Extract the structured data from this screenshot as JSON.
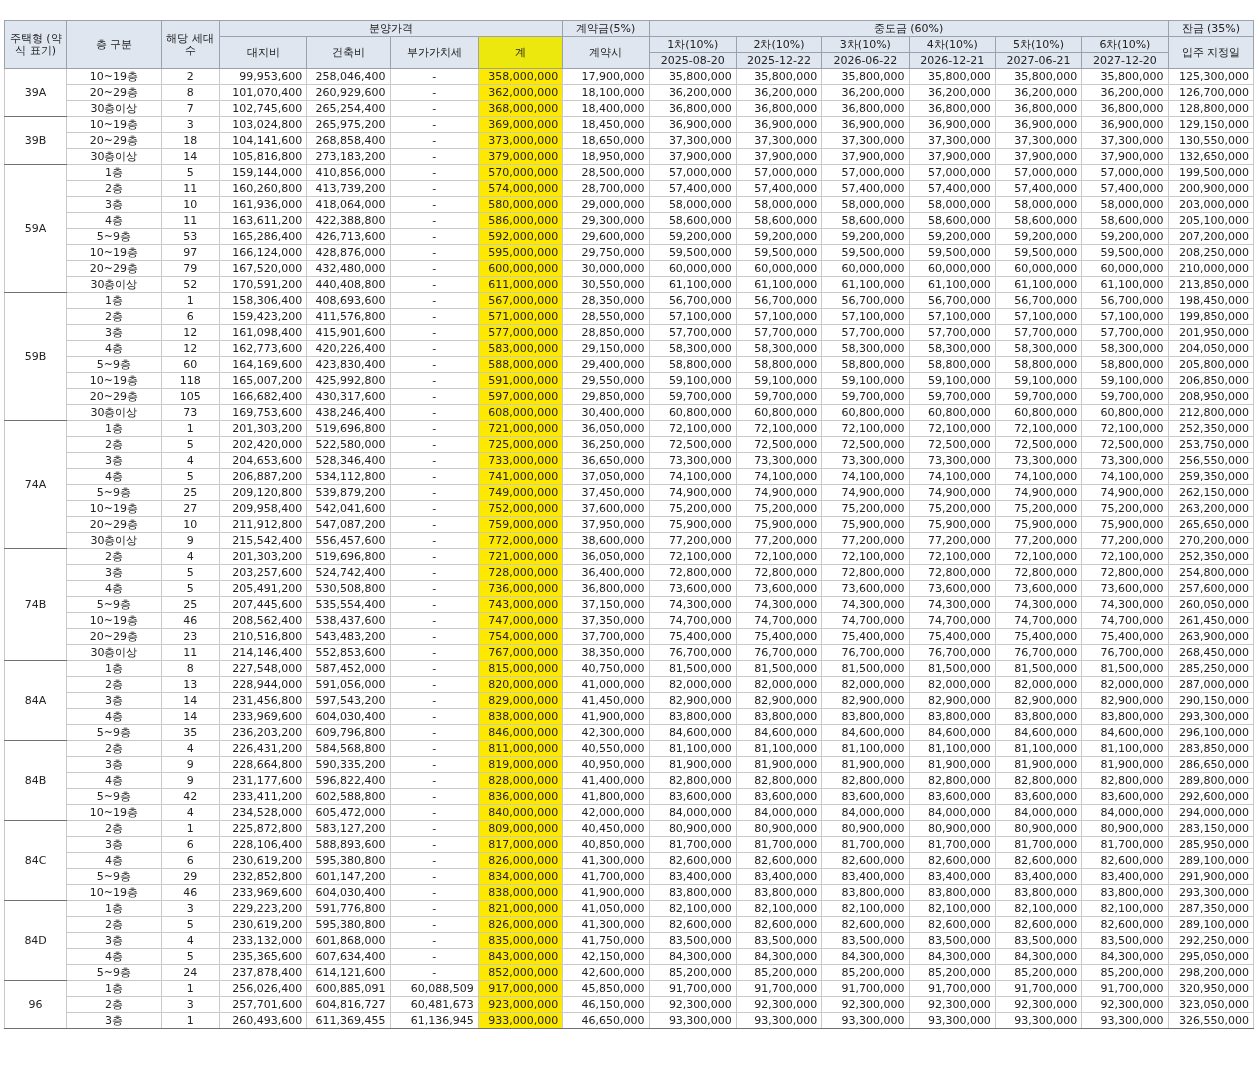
{
  "header": {
    "housing_type": "주택형 (약식 표기)",
    "floor": "층 구분",
    "units": "해당 세대수",
    "price": {
      "label": "분양가격",
      "columns": [
        {
          "label": "대지비",
          "highlighted": false
        },
        {
          "label": "건축비",
          "highlighted": false
        },
        {
          "label": "부가가치세",
          "highlighted": false
        },
        {
          "label": "계",
          "highlighted": true
        }
      ]
    },
    "deposit": {
      "label": "계약금(5%)",
      "sub": "계약시"
    },
    "middle": {
      "label": "중도금 (60%)",
      "installments": [
        {
          "label": "1차(10%)",
          "date": "2025-08-20"
        },
        {
          "label": "2차(10%)",
          "date": "2025-12-22"
        },
        {
          "label": "3차(10%)",
          "date": "2026-06-22"
        },
        {
          "label": "4차(10%)",
          "date": "2026-12-21"
        },
        {
          "label": "5차(10%)",
          "date": "2027-06-21"
        },
        {
          "label": "6차(10%)",
          "date": "2027-12-20"
        }
      ]
    },
    "balance": {
      "label": "잔금 (35%)",
      "sub": "입주 지정일"
    }
  },
  "groups": [
    {
      "type": "39A",
      "rows": [
        [
          "10~19층",
          "2",
          "99,953,600",
          "258,046,400",
          "-",
          "358,000,000",
          "17,900,000",
          "35,800,000",
          "35,800,000",
          "35,800,000",
          "35,800,000",
          "35,800,000",
          "35,800,000",
          "125,300,000"
        ],
        [
          "20~29층",
          "8",
          "101,070,400",
          "260,929,600",
          "-",
          "362,000,000",
          "18,100,000",
          "36,200,000",
          "36,200,000",
          "36,200,000",
          "36,200,000",
          "36,200,000",
          "36,200,000",
          "126,700,000"
        ],
        [
          "30층이상",
          "7",
          "102,745,600",
          "265,254,400",
          "-",
          "368,000,000",
          "18,400,000",
          "36,800,000",
          "36,800,000",
          "36,800,000",
          "36,800,000",
          "36,800,000",
          "36,800,000",
          "128,800,000"
        ]
      ]
    },
    {
      "type": "39B",
      "rows": [
        [
          "10~19층",
          "3",
          "103,024,800",
          "265,975,200",
          "-",
          "369,000,000",
          "18,450,000",
          "36,900,000",
          "36,900,000",
          "36,900,000",
          "36,900,000",
          "36,900,000",
          "36,900,000",
          "129,150,000"
        ],
        [
          "20~29층",
          "18",
          "104,141,600",
          "268,858,400",
          "-",
          "373,000,000",
          "18,650,000",
          "37,300,000",
          "37,300,000",
          "37,300,000",
          "37,300,000",
          "37,300,000",
          "37,300,000",
          "130,550,000"
        ],
        [
          "30층이상",
          "14",
          "105,816,800",
          "273,183,200",
          "-",
          "379,000,000",
          "18,950,000",
          "37,900,000",
          "37,900,000",
          "37,900,000",
          "37,900,000",
          "37,900,000",
          "37,900,000",
          "132,650,000"
        ]
      ]
    },
    {
      "type": "59A",
      "rows": [
        [
          "1층",
          "5",
          "159,144,000",
          "410,856,000",
          "-",
          "570,000,000",
          "28,500,000",
          "57,000,000",
          "57,000,000",
          "57,000,000",
          "57,000,000",
          "57,000,000",
          "57,000,000",
          "199,500,000"
        ],
        [
          "2층",
          "11",
          "160,260,800",
          "413,739,200",
          "-",
          "574,000,000",
          "28,700,000",
          "57,400,000",
          "57,400,000",
          "57,400,000",
          "57,400,000",
          "57,400,000",
          "57,400,000",
          "200,900,000"
        ],
        [
          "3층",
          "10",
          "161,936,000",
          "418,064,000",
          "-",
          "580,000,000",
          "29,000,000",
          "58,000,000",
          "58,000,000",
          "58,000,000",
          "58,000,000",
          "58,000,000",
          "58,000,000",
          "203,000,000"
        ],
        [
          "4층",
          "11",
          "163,611,200",
          "422,388,800",
          "-",
          "586,000,000",
          "29,300,000",
          "58,600,000",
          "58,600,000",
          "58,600,000",
          "58,600,000",
          "58,600,000",
          "58,600,000",
          "205,100,000"
        ],
        [
          "5~9층",
          "53",
          "165,286,400",
          "426,713,600",
          "-",
          "592,000,000",
          "29,600,000",
          "59,200,000",
          "59,200,000",
          "59,200,000",
          "59,200,000",
          "59,200,000",
          "59,200,000",
          "207,200,000"
        ],
        [
          "10~19층",
          "97",
          "166,124,000",
          "428,876,000",
          "-",
          "595,000,000",
          "29,750,000",
          "59,500,000",
          "59,500,000",
          "59,500,000",
          "59,500,000",
          "59,500,000",
          "59,500,000",
          "208,250,000"
        ],
        [
          "20~29층",
          "79",
          "167,520,000",
          "432,480,000",
          "-",
          "600,000,000",
          "30,000,000",
          "60,000,000",
          "60,000,000",
          "60,000,000",
          "60,000,000",
          "60,000,000",
          "60,000,000",
          "210,000,000"
        ],
        [
          "30층이상",
          "52",
          "170,591,200",
          "440,408,800",
          "-",
          "611,000,000",
          "30,550,000",
          "61,100,000",
          "61,100,000",
          "61,100,000",
          "61,100,000",
          "61,100,000",
          "61,100,000",
          "213,850,000"
        ]
      ]
    },
    {
      "type": "59B",
      "rows": [
        [
          "1층",
          "1",
          "158,306,400",
          "408,693,600",
          "-",
          "567,000,000",
          "28,350,000",
          "56,700,000",
          "56,700,000",
          "56,700,000",
          "56,700,000",
          "56,700,000",
          "56,700,000",
          "198,450,000"
        ],
        [
          "2층",
          "6",
          "159,423,200",
          "411,576,800",
          "-",
          "571,000,000",
          "28,550,000",
          "57,100,000",
          "57,100,000",
          "57,100,000",
          "57,100,000",
          "57,100,000",
          "57,100,000",
          "199,850,000"
        ],
        [
          "3층",
          "12",
          "161,098,400",
          "415,901,600",
          "-",
          "577,000,000",
          "28,850,000",
          "57,700,000",
          "57,700,000",
          "57,700,000",
          "57,700,000",
          "57,700,000",
          "57,700,000",
          "201,950,000"
        ],
        [
          "4층",
          "12",
          "162,773,600",
          "420,226,400",
          "-",
          "583,000,000",
          "29,150,000",
          "58,300,000",
          "58,300,000",
          "58,300,000",
          "58,300,000",
          "58,300,000",
          "58,300,000",
          "204,050,000"
        ],
        [
          "5~9층",
          "60",
          "164,169,600",
          "423,830,400",
          "-",
          "588,000,000",
          "29,400,000",
          "58,800,000",
          "58,800,000",
          "58,800,000",
          "58,800,000",
          "58,800,000",
          "58,800,000",
          "205,800,000"
        ],
        [
          "10~19층",
          "118",
          "165,007,200",
          "425,992,800",
          "-",
          "591,000,000",
          "29,550,000",
          "59,100,000",
          "59,100,000",
          "59,100,000",
          "59,100,000",
          "59,100,000",
          "59,100,000",
          "206,850,000"
        ],
        [
          "20~29층",
          "105",
          "166,682,400",
          "430,317,600",
          "-",
          "597,000,000",
          "29,850,000",
          "59,700,000",
          "59,700,000",
          "59,700,000",
          "59,700,000",
          "59,700,000",
          "59,700,000",
          "208,950,000"
        ],
        [
          "30층이상",
          "73",
          "169,753,600",
          "438,246,400",
          "-",
          "608,000,000",
          "30,400,000",
          "60,800,000",
          "60,800,000",
          "60,800,000",
          "60,800,000",
          "60,800,000",
          "60,800,000",
          "212,800,000"
        ]
      ]
    },
    {
      "type": "74A",
      "rows": [
        [
          "1층",
          "1",
          "201,303,200",
          "519,696,800",
          "-",
          "721,000,000",
          "36,050,000",
          "72,100,000",
          "72,100,000",
          "72,100,000",
          "72,100,000",
          "72,100,000",
          "72,100,000",
          "252,350,000"
        ],
        [
          "2층",
          "5",
          "202,420,000",
          "522,580,000",
          "-",
          "725,000,000",
          "36,250,000",
          "72,500,000",
          "72,500,000",
          "72,500,000",
          "72,500,000",
          "72,500,000",
          "72,500,000",
          "253,750,000"
        ],
        [
          "3층",
          "4",
          "204,653,600",
          "528,346,400",
          "-",
          "733,000,000",
          "36,650,000",
          "73,300,000",
          "73,300,000",
          "73,300,000",
          "73,300,000",
          "73,300,000",
          "73,300,000",
          "256,550,000"
        ],
        [
          "4층",
          "5",
          "206,887,200",
          "534,112,800",
          "-",
          "741,000,000",
          "37,050,000",
          "74,100,000",
          "74,100,000",
          "74,100,000",
          "74,100,000",
          "74,100,000",
          "74,100,000",
          "259,350,000"
        ],
        [
          "5~9층",
          "25",
          "209,120,800",
          "539,879,200",
          "-",
          "749,000,000",
          "37,450,000",
          "74,900,000",
          "74,900,000",
          "74,900,000",
          "74,900,000",
          "74,900,000",
          "74,900,000",
          "262,150,000"
        ],
        [
          "10~19층",
          "27",
          "209,958,400",
          "542,041,600",
          "-",
          "752,000,000",
          "37,600,000",
          "75,200,000",
          "75,200,000",
          "75,200,000",
          "75,200,000",
          "75,200,000",
          "75,200,000",
          "263,200,000"
        ],
        [
          "20~29층",
          "10",
          "211,912,800",
          "547,087,200",
          "-",
          "759,000,000",
          "37,950,000",
          "75,900,000",
          "75,900,000",
          "75,900,000",
          "75,900,000",
          "75,900,000",
          "75,900,000",
          "265,650,000"
        ],
        [
          "30층이상",
          "9",
          "215,542,400",
          "556,457,600",
          "-",
          "772,000,000",
          "38,600,000",
          "77,200,000",
          "77,200,000",
          "77,200,000",
          "77,200,000",
          "77,200,000",
          "77,200,000",
          "270,200,000"
        ]
      ]
    },
    {
      "type": "74B",
      "rows": [
        [
          "2층",
          "4",
          "201,303,200",
          "519,696,800",
          "-",
          "721,000,000",
          "36,050,000",
          "72,100,000",
          "72,100,000",
          "72,100,000",
          "72,100,000",
          "72,100,000",
          "72,100,000",
          "252,350,000"
        ],
        [
          "3층",
          "5",
          "203,257,600",
          "524,742,400",
          "-",
          "728,000,000",
          "36,400,000",
          "72,800,000",
          "72,800,000",
          "72,800,000",
          "72,800,000",
          "72,800,000",
          "72,800,000",
          "254,800,000"
        ],
        [
          "4층",
          "5",
          "205,491,200",
          "530,508,800",
          "-",
          "736,000,000",
          "36,800,000",
          "73,600,000",
          "73,600,000",
          "73,600,000",
          "73,600,000",
          "73,600,000",
          "73,600,000",
          "257,600,000"
        ],
        [
          "5~9층",
          "25",
          "207,445,600",
          "535,554,400",
          "-",
          "743,000,000",
          "37,150,000",
          "74,300,000",
          "74,300,000",
          "74,300,000",
          "74,300,000",
          "74,300,000",
          "74,300,000",
          "260,050,000"
        ],
        [
          "10~19층",
          "46",
          "208,562,400",
          "538,437,600",
          "-",
          "747,000,000",
          "37,350,000",
          "74,700,000",
          "74,700,000",
          "74,700,000",
          "74,700,000",
          "74,700,000",
          "74,700,000",
          "261,450,000"
        ],
        [
          "20~29층",
          "23",
          "210,516,800",
          "543,483,200",
          "-",
          "754,000,000",
          "37,700,000",
          "75,400,000",
          "75,400,000",
          "75,400,000",
          "75,400,000",
          "75,400,000",
          "75,400,000",
          "263,900,000"
        ],
        [
          "30층이상",
          "11",
          "214,146,400",
          "552,853,600",
          "-",
          "767,000,000",
          "38,350,000",
          "76,700,000",
          "76,700,000",
          "76,700,000",
          "76,700,000",
          "76,700,000",
          "76,700,000",
          "268,450,000"
        ]
      ]
    },
    {
      "type": "84A",
      "rows": [
        [
          "1층",
          "8",
          "227,548,000",
          "587,452,000",
          "-",
          "815,000,000",
          "40,750,000",
          "81,500,000",
          "81,500,000",
          "81,500,000",
          "81,500,000",
          "81,500,000",
          "81,500,000",
          "285,250,000"
        ],
        [
          "2층",
          "13",
          "228,944,000",
          "591,056,000",
          "-",
          "820,000,000",
          "41,000,000",
          "82,000,000",
          "82,000,000",
          "82,000,000",
          "82,000,000",
          "82,000,000",
          "82,000,000",
          "287,000,000"
        ],
        [
          "3층",
          "14",
          "231,456,800",
          "597,543,200",
          "-",
          "829,000,000",
          "41,450,000",
          "82,900,000",
          "82,900,000",
          "82,900,000",
          "82,900,000",
          "82,900,000",
          "82,900,000",
          "290,150,000"
        ],
        [
          "4층",
          "14",
          "233,969,600",
          "604,030,400",
          "-",
          "838,000,000",
          "41,900,000",
          "83,800,000",
          "83,800,000",
          "83,800,000",
          "83,800,000",
          "83,800,000",
          "83,800,000",
          "293,300,000"
        ],
        [
          "5~9층",
          "35",
          "236,203,200",
          "609,796,800",
          "-",
          "846,000,000",
          "42,300,000",
          "84,600,000",
          "84,600,000",
          "84,600,000",
          "84,600,000",
          "84,600,000",
          "84,600,000",
          "296,100,000"
        ]
      ]
    },
    {
      "type": "84B",
      "rows": [
        [
          "2층",
          "4",
          "226,431,200",
          "584,568,800",
          "-",
          "811,000,000",
          "40,550,000",
          "81,100,000",
          "81,100,000",
          "81,100,000",
          "81,100,000",
          "81,100,000",
          "81,100,000",
          "283,850,000"
        ],
        [
          "3층",
          "9",
          "228,664,800",
          "590,335,200",
          "-",
          "819,000,000",
          "40,950,000",
          "81,900,000",
          "81,900,000",
          "81,900,000",
          "81,900,000",
          "81,900,000",
          "81,900,000",
          "286,650,000"
        ],
        [
          "4층",
          "9",
          "231,177,600",
          "596,822,400",
          "-",
          "828,000,000",
          "41,400,000",
          "82,800,000",
          "82,800,000",
          "82,800,000",
          "82,800,000",
          "82,800,000",
          "82,800,000",
          "289,800,000"
        ],
        [
          "5~9층",
          "42",
          "233,411,200",
          "602,588,800",
          "-",
          "836,000,000",
          "41,800,000",
          "83,600,000",
          "83,600,000",
          "83,600,000",
          "83,600,000",
          "83,600,000",
          "83,600,000",
          "292,600,000"
        ],
        [
          "10~19층",
          "4",
          "234,528,000",
          "605,472,000",
          "-",
          "840,000,000",
          "42,000,000",
          "84,000,000",
          "84,000,000",
          "84,000,000",
          "84,000,000",
          "84,000,000",
          "84,000,000",
          "294,000,000"
        ]
      ]
    },
    {
      "type": "84C",
      "rows": [
        [
          "2층",
          "1",
          "225,872,800",
          "583,127,200",
          "-",
          "809,000,000",
          "40,450,000",
          "80,900,000",
          "80,900,000",
          "80,900,000",
          "80,900,000",
          "80,900,000",
          "80,900,000",
          "283,150,000"
        ],
        [
          "3층",
          "6",
          "228,106,400",
          "588,893,600",
          "-",
          "817,000,000",
          "40,850,000",
          "81,700,000",
          "81,700,000",
          "81,700,000",
          "81,700,000",
          "81,700,000",
          "81,700,000",
          "285,950,000"
        ],
        [
          "4층",
          "6",
          "230,619,200",
          "595,380,800",
          "-",
          "826,000,000",
          "41,300,000",
          "82,600,000",
          "82,600,000",
          "82,600,000",
          "82,600,000",
          "82,600,000",
          "82,600,000",
          "289,100,000"
        ],
        [
          "5~9층",
          "29",
          "232,852,800",
          "601,147,200",
          "-",
          "834,000,000",
          "41,700,000",
          "83,400,000",
          "83,400,000",
          "83,400,000",
          "83,400,000",
          "83,400,000",
          "83,400,000",
          "291,900,000"
        ],
        [
          "10~19층",
          "46",
          "233,969,600",
          "604,030,400",
          "-",
          "838,000,000",
          "41,900,000",
          "83,800,000",
          "83,800,000",
          "83,800,000",
          "83,800,000",
          "83,800,000",
          "83,800,000",
          "293,300,000"
        ]
      ]
    },
    {
      "type": "84D",
      "rows": [
        [
          "1층",
          "3",
          "229,223,200",
          "591,776,800",
          "-",
          "821,000,000",
          "41,050,000",
          "82,100,000",
          "82,100,000",
          "82,100,000",
          "82,100,000",
          "82,100,000",
          "82,100,000",
          "287,350,000"
        ],
        [
          "2층",
          "5",
          "230,619,200",
          "595,380,800",
          "-",
          "826,000,000",
          "41,300,000",
          "82,600,000",
          "82,600,000",
          "82,600,000",
          "82,600,000",
          "82,600,000",
          "82,600,000",
          "289,100,000"
        ],
        [
          "3층",
          "4",
          "233,132,000",
          "601,868,000",
          "-",
          "835,000,000",
          "41,750,000",
          "83,500,000",
          "83,500,000",
          "83,500,000",
          "83,500,000",
          "83,500,000",
          "83,500,000",
          "292,250,000"
        ],
        [
          "4층",
          "5",
          "235,365,600",
          "607,634,400",
          "-",
          "843,000,000",
          "42,150,000",
          "84,300,000",
          "84,300,000",
          "84,300,000",
          "84,300,000",
          "84,300,000",
          "84,300,000",
          "295,050,000"
        ],
        [
          "5~9층",
          "24",
          "237,878,400",
          "614,121,600",
          "-",
          "852,000,000",
          "42,600,000",
          "85,200,000",
          "85,200,000",
          "85,200,000",
          "85,200,000",
          "85,200,000",
          "85,200,000",
          "298,200,000"
        ]
      ]
    },
    {
      "type": "96",
      "rows": [
        [
          "1층",
          "1",
          "256,026,400",
          "600,885,091",
          "60,088,509",
          "917,000,000",
          "45,850,000",
          "91,700,000",
          "91,700,000",
          "91,700,000",
          "91,700,000",
          "91,700,000",
          "91,700,000",
          "320,950,000"
        ],
        [
          "2층",
          "3",
          "257,701,600",
          "604,816,727",
          "60,481,673",
          "923,000,000",
          "46,150,000",
          "92,300,000",
          "92,300,000",
          "92,300,000",
          "92,300,000",
          "92,300,000",
          "92,300,000",
          "323,050,000"
        ],
        [
          "3층",
          "1",
          "260,493,600",
          "611,369,455",
          "61,136,945",
          "933,000,000",
          "46,650,000",
          "93,300,000",
          "93,300,000",
          "93,300,000",
          "93,300,000",
          "93,300,000",
          "93,300,000",
          "326,550,000"
        ]
      ]
    }
  ]
}
